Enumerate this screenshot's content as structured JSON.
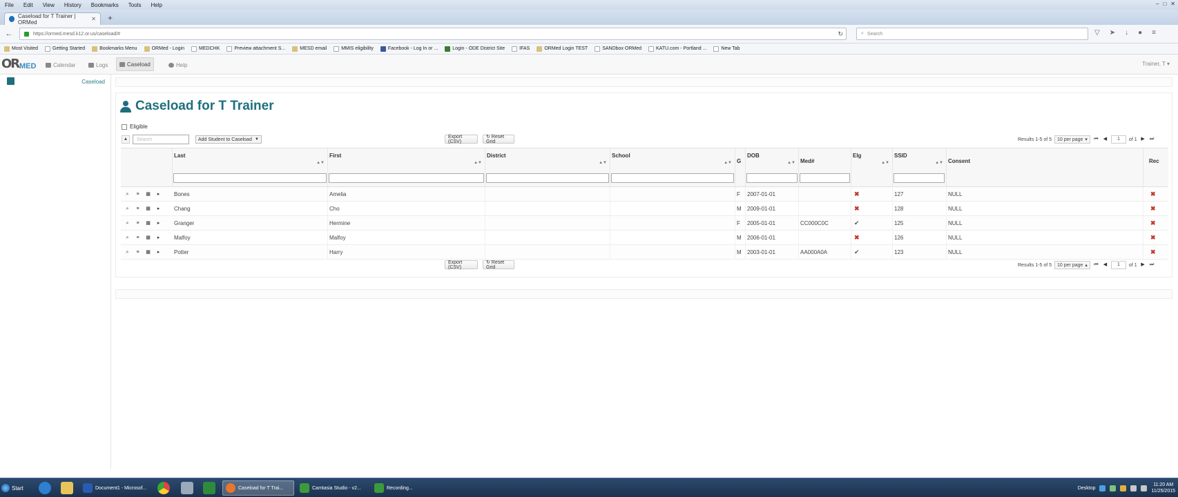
{
  "browser": {
    "menu": [
      "File",
      "Edit",
      "View",
      "History",
      "Bookmarks",
      "Tools",
      "Help"
    ],
    "tab_title": "Caseload for T Trainer | ORMed",
    "new_tab_glyph": "+",
    "url": "https://ormed.mesd.k12.or.us/caseload/#",
    "search_placeholder": "Search",
    "bookmarks": [
      "Most Visited",
      "Getting Started",
      "Bookmarks Menu",
      "ORMed - Login",
      "MEDCHK",
      "Preview attachment S...",
      "MESD email",
      "MMIS eligibility",
      "Facebook - Log In or ...",
      "Login - ODE District Site",
      "IFAS",
      "ORMed Login TEST",
      "SANDbox ORMed",
      "KATU.com - Portland ...",
      "New Tab"
    ]
  },
  "app": {
    "logo_or": "OR",
    "logo_med": "MED",
    "nav": [
      {
        "label": "Calendar",
        "icon": "calendar-icon"
      },
      {
        "label": "Logs",
        "icon": "list-icon"
      },
      {
        "label": "Caseload",
        "icon": "caseload-icon"
      },
      {
        "label": "Help",
        "icon": "help-icon"
      }
    ],
    "user": "Trainer, T ▾"
  },
  "sidebar": {
    "caseload_link": "Caseload"
  },
  "page": {
    "title": "Caseload for T Trainer",
    "eligible_label": "Eligible",
    "search_placeholder": "Search",
    "add_student": "Add Student to Caseload",
    "export_label": "Export (CSV)",
    "reset_label": "↻ Reset Grid",
    "results": "Results 1-5 of 5",
    "per_page": "10 per page",
    "page_number": "1",
    "of_pages": "of 1"
  },
  "grid": {
    "columns": [
      "Last",
      "First",
      "District",
      "School",
      "G",
      "DOB",
      "Med#",
      "Elg",
      "SSID",
      "Consent",
      "Rec"
    ],
    "rows": [
      {
        "last": "Bones",
        "first": "Amelia",
        "district": "",
        "school": "",
        "g": "F",
        "dob": "2007-01-01",
        "med": "",
        "elg": "✖",
        "ssid": "127",
        "consent": "NULL",
        "rec": "✖"
      },
      {
        "last": "Chang",
        "first": "Cho",
        "district": "",
        "school": "",
        "g": "M",
        "dob": "2009-01-01",
        "med": "",
        "elg": "✖",
        "ssid": "128",
        "consent": "NULL",
        "rec": "✖"
      },
      {
        "last": "Granger",
        "first": "Hermine",
        "district": "",
        "school": "",
        "g": "F",
        "dob": "2005-01-01",
        "med": "CC000C0C",
        "elg": "✔",
        "ssid": "125",
        "consent": "NULL",
        "rec": "✖"
      },
      {
        "last": "Malfoy",
        "first": "Malfoy",
        "district": "",
        "school": "",
        "g": "M",
        "dob": "2006-01-01",
        "med": "",
        "elg": "✖",
        "ssid": "126",
        "consent": "NULL",
        "rec": "✖"
      },
      {
        "last": "Potter",
        "first": "Harry",
        "district": "",
        "school": "",
        "g": "M",
        "dob": "2003-01-01",
        "med": "AA000A0A",
        "elg": "✔",
        "ssid": "123",
        "consent": "NULL",
        "rec": "✖"
      }
    ]
  },
  "taskbar": {
    "start": "Start",
    "tasks": [
      "Document1 - Microsof...",
      "Caseload for T Trai...",
      "Camtasia Studio - v2...",
      "Recording..."
    ],
    "desktop": "Desktop",
    "time": "11:20 AM",
    "date": "11/25/2015"
  },
  "colors": {
    "accent": "#1f6f7d",
    "danger": "#c0392b"
  }
}
